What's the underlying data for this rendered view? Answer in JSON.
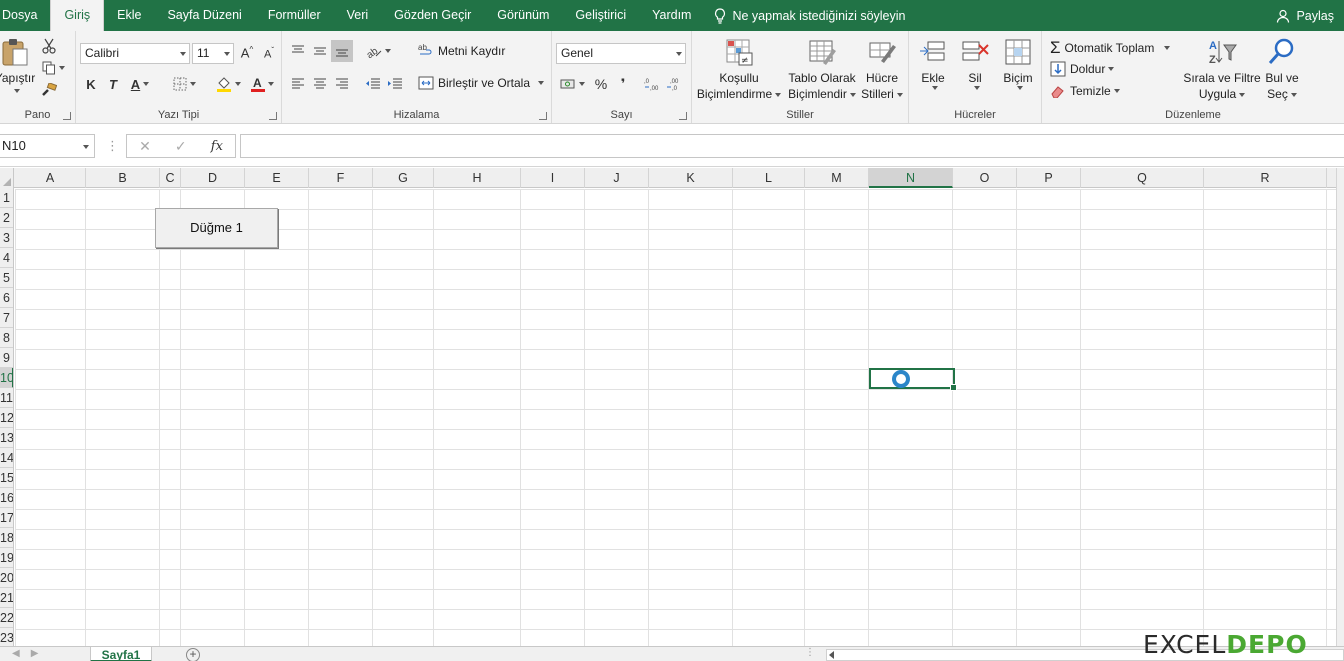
{
  "menu": {
    "items": [
      "Dosya",
      "Giriş",
      "Ekle",
      "Sayfa Düzeni",
      "Formüller",
      "Veri",
      "Gözden Geçir",
      "Görünüm",
      "Geliştirici",
      "Yardım"
    ],
    "active_index": 1,
    "tell_me": "Ne yapmak istediğinizi söyleyin",
    "share": "Paylaş"
  },
  "ribbon": {
    "pano": {
      "paste": "Yapıştır",
      "label": "Pano"
    },
    "font": {
      "name": "Calibri",
      "size": "11",
      "bold": "K",
      "italic": "T",
      "underline": "A",
      "label": "Yazı Tipi"
    },
    "alignment": {
      "wrap": "Metni Kaydır",
      "merge": "Birleştir ve Ortala",
      "label": "Hizalama"
    },
    "number": {
      "format": "Genel",
      "percent": "%",
      "comma": "❜",
      "label": "Sayı"
    },
    "styles": {
      "conditional_1": "Koşullu",
      "conditional_2": "Biçimlendirme",
      "table_1": "Tablo Olarak",
      "table_2": "Biçimlendir",
      "cell_1": "Hücre",
      "cell_2": "Stilleri",
      "label": "Stiller"
    },
    "cells": {
      "insert": "Ekle",
      "delete": "Sil",
      "format": "Biçim",
      "label": "Hücreler"
    },
    "editing": {
      "autosum": "Otomatik Toplam",
      "fill": "Doldur",
      "clear": "Temizle",
      "sort_1": "Sırala ve Filtre",
      "sort_2": "Uygula",
      "find_1": "Bul ve",
      "find_2": "Seç",
      "label": "Düzenleme"
    }
  },
  "formula_bar": {
    "name_box": "N10",
    "cancel": "✕",
    "enter": "✓",
    "fx": "fx",
    "value": ""
  },
  "grid": {
    "columns": [
      "A",
      "B",
      "C",
      "D",
      "E",
      "F",
      "G",
      "H",
      "I",
      "J",
      "K",
      "L",
      "M",
      "N",
      "O",
      "P",
      "Q",
      "R"
    ],
    "rows": [
      "1",
      "2",
      "3",
      "4",
      "5",
      "6",
      "7",
      "8",
      "9",
      "10",
      "11",
      "12",
      "13",
      "14",
      "15",
      "16",
      "17",
      "18",
      "19",
      "20",
      "21",
      "22",
      "23"
    ],
    "active_column": "N",
    "active_row": "10",
    "form_button_label": "Düğme 1"
  },
  "sheets": {
    "tabs": [
      "Sayfa1"
    ],
    "add": "+"
  },
  "watermark": {
    "part1": "EXCEL",
    "part2": "DEPO"
  },
  "colors": {
    "excel_green": "#217346",
    "cursor_blue": "#2b86c9"
  }
}
